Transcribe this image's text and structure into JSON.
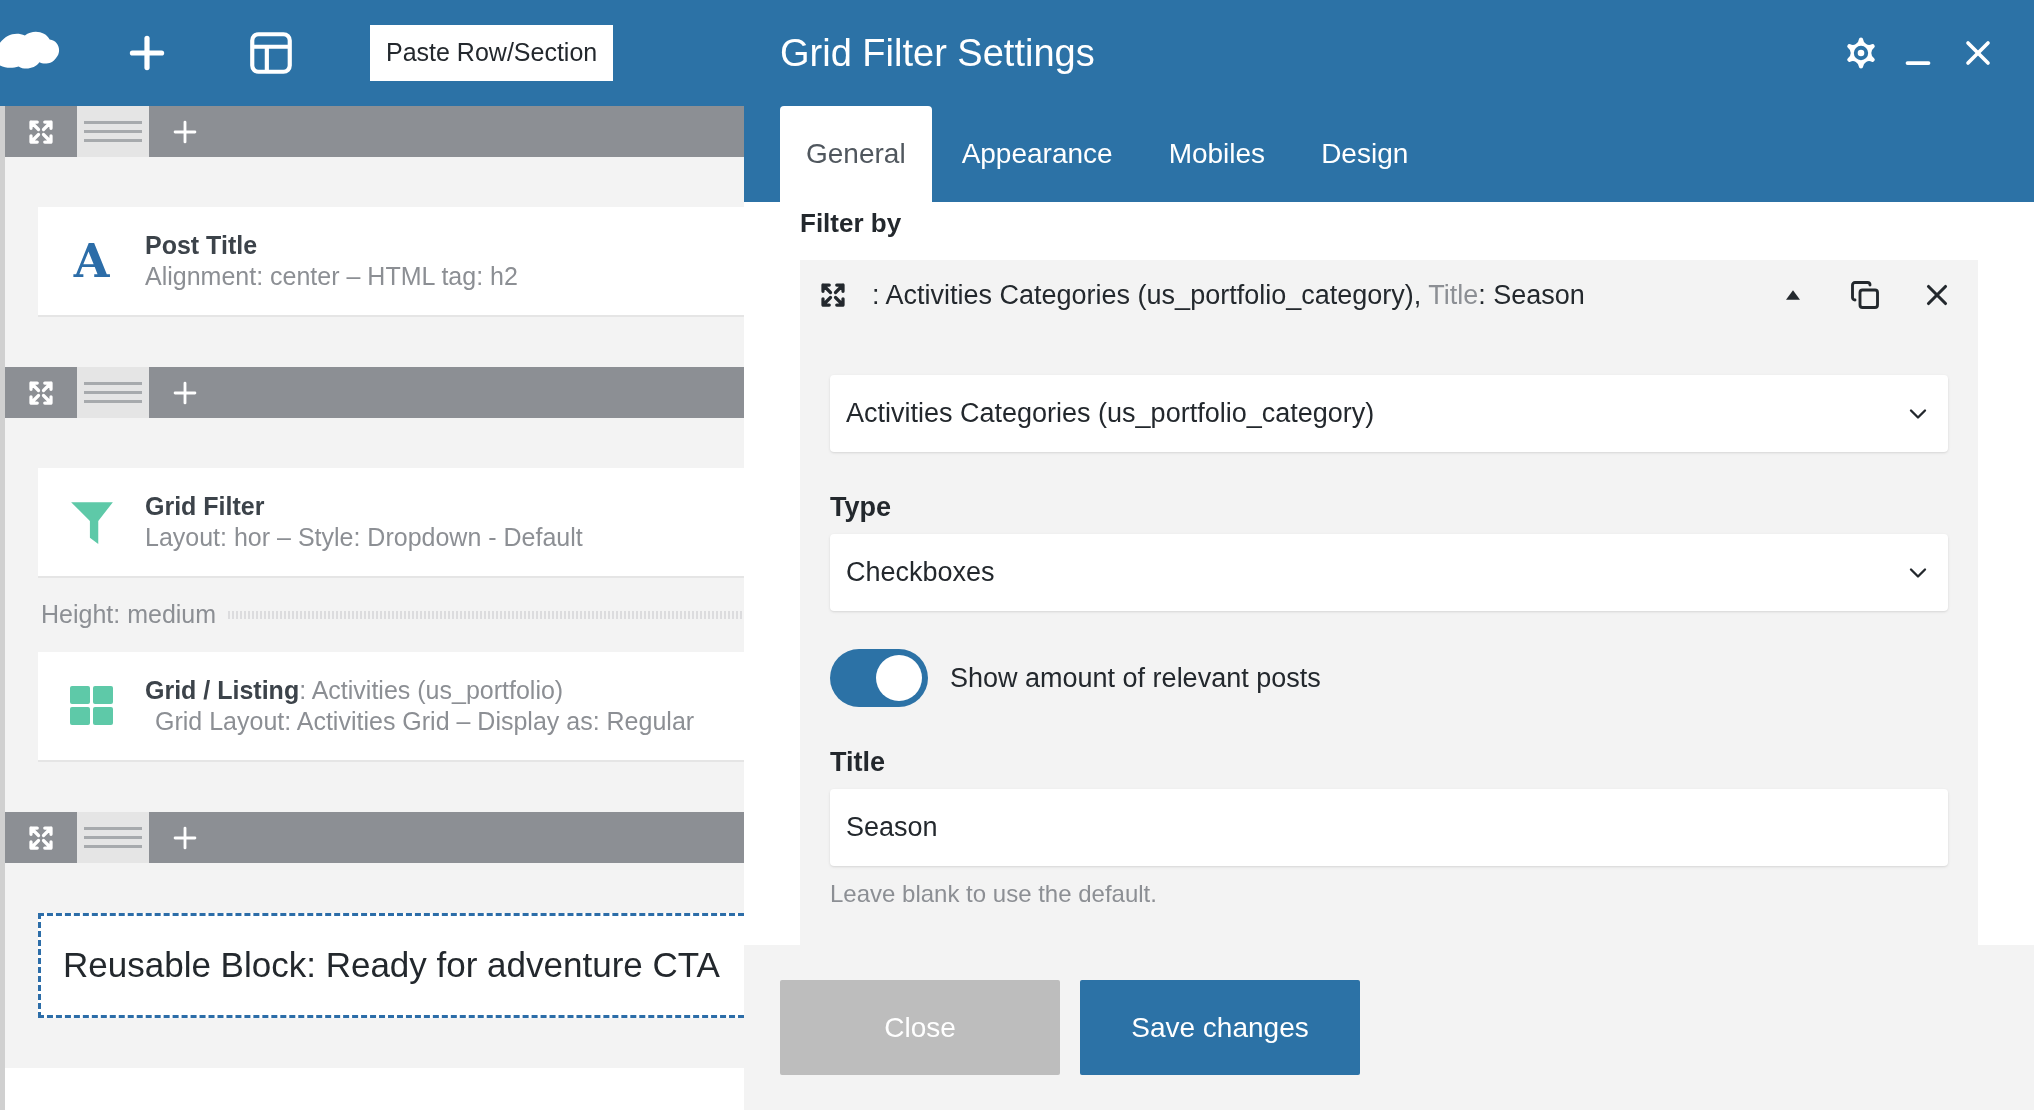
{
  "toolbar": {
    "paste_button": "Paste Row/Section"
  },
  "sections": [
    {
      "elements": [
        {
          "kind": "text",
          "icon_text": "A",
          "title": "Post Title",
          "details": "Alignment: center – HTML tag: h2"
        }
      ]
    },
    {
      "elements": [
        {
          "kind": "filter",
          "title": "Grid Filter",
          "details": "Layout: hor – Style: Dropdown - Default"
        },
        {
          "kind": "height",
          "title": "Height: medium"
        },
        {
          "kind": "grid",
          "title": "**Grid / Listing**: Activities (us_portfolio)",
          "details": "Grid Layout: Activities Grid – Display as: Regular"
        }
      ]
    },
    {
      "elements": [
        {
          "kind": "reusable",
          "title": "Reusable Block: Ready for adventure CTA"
        }
      ]
    }
  ],
  "dialog": {
    "title": "Grid Filter Settings",
    "tabs": [
      {
        "label": "General",
        "selected": true
      },
      {
        "label": "Appearance",
        "selected": false
      },
      {
        "label": "Mobiles",
        "selected": false
      },
      {
        "label": "Design",
        "selected": false
      }
    ],
    "filter_by_label": "Filter by",
    "filter_item": {
      "header": ": Activities Categories (us_portfolio_category), ",
      "header_key": "Title",
      "header_value": ": Season",
      "expanded": true,
      "source": "Activities Categories (us_portfolio_category)",
      "type_label": "Type",
      "type_value": "Checkboxes",
      "toggle": {
        "label": "Show amount of relevant posts",
        "on": true
      },
      "title_label": "Title",
      "title_value": "Season",
      "title_hint": "Leave blank to use the default."
    },
    "buttons": [
      {
        "label": "Close",
        "kind": "secondary"
      },
      {
        "label": "Save changes",
        "kind": "primary"
      }
    ]
  }
}
